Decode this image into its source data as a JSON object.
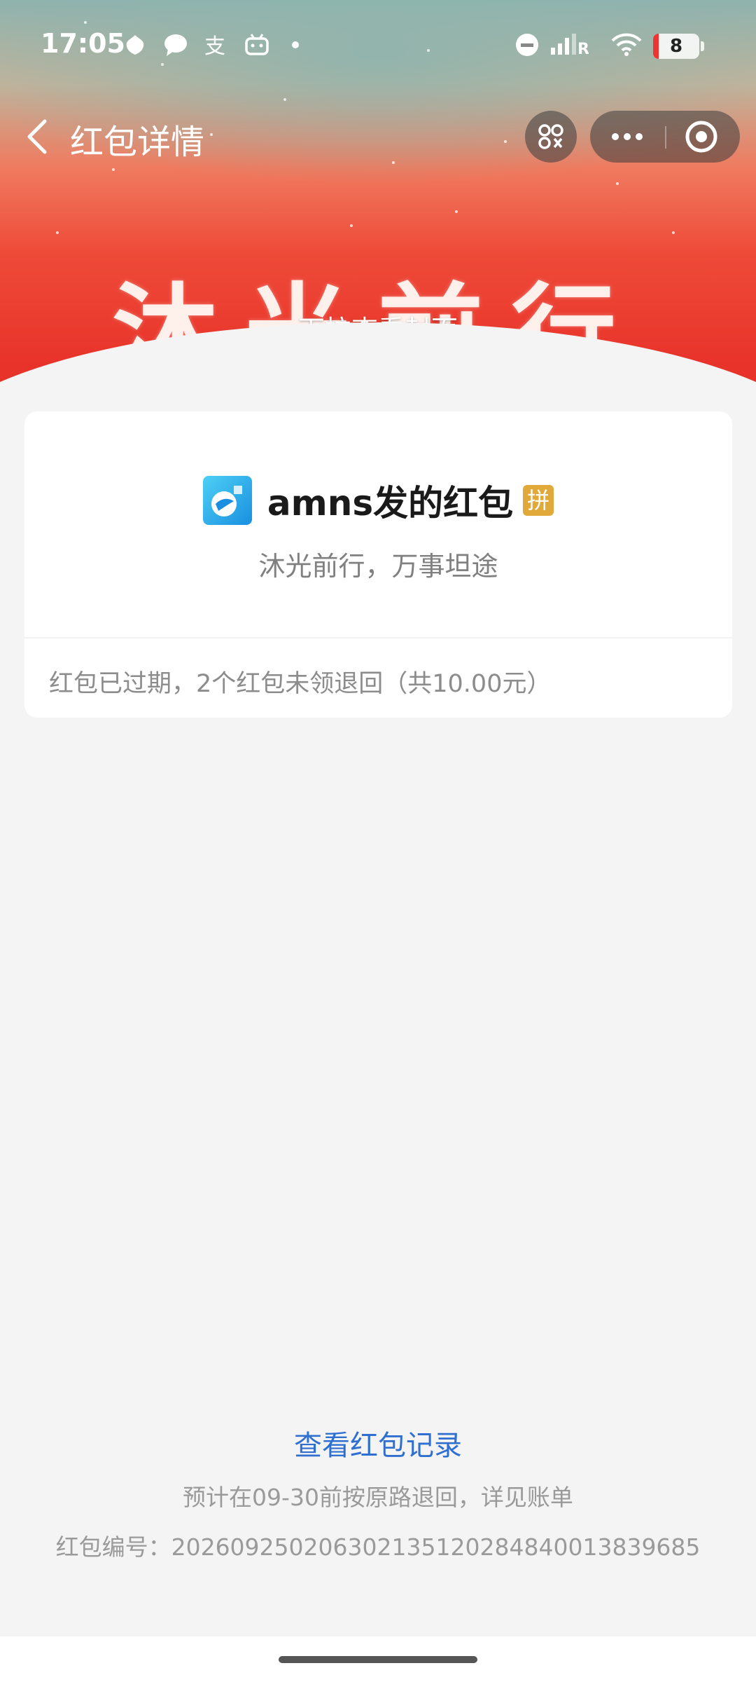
{
  "status_bar": {
    "time": "17:05",
    "icons": [
      "petal-icon",
      "chat-bubble-icon",
      "alipay-icon",
      "bilibili-icon",
      "dot-icon",
      "dnd-icon",
      "signal-icon",
      "wifi-icon"
    ],
    "battery": "8"
  },
  "nav": {
    "title": "红包详情"
  },
  "cover": {
    "title": "沐光前行",
    "pull_hint": "下拉查看封面"
  },
  "card": {
    "sender": "amns发的红包",
    "badge": "拼",
    "blessing": "沐光前行，万事坦途",
    "status_note": "红包已过期，2个红包未领退回（共10.00元）"
  },
  "footer": {
    "record_link": "查看红包记录",
    "refund_note": "预计在09-30前按原路退回，详见账单",
    "serial": "红包编号：2026092502063021351202848400138396​85"
  },
  "colors": {
    "banner_red": "#e83128",
    "link_blue": "#2f6fd0",
    "badge_gold": "#e0a93a",
    "page_bg": "#f4f4f4"
  }
}
